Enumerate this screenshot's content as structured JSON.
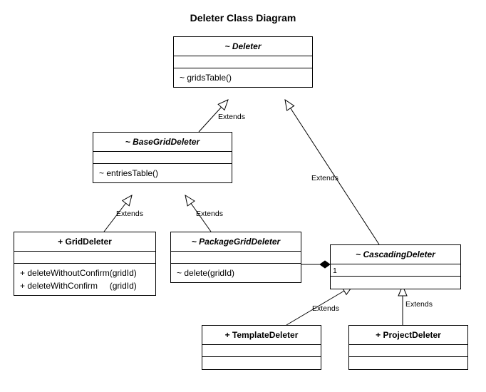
{
  "title": "Deleter Class Diagram",
  "labels": {
    "extends1": "Extends",
    "extends2": "Extends",
    "extends3": "Extends",
    "extends4": "Extends",
    "extends5": "Extends",
    "extends6": "Extends",
    "mult1": "1"
  },
  "classes": {
    "deleter": {
      "name": "~ Deleter",
      "methods": [
        "~ gridsTable()"
      ]
    },
    "baseGridDeleter": {
      "name": "~ BaseGridDeleter",
      "methods": [
        "~ entriesTable()"
      ]
    },
    "gridDeleter": {
      "name": "+ GridDeleter",
      "methods": [
        {
          "sig": "+ deleteWithoutConfirm",
          "args": "(gridId)"
        },
        {
          "sig": "+ deleteWithConfirm",
          "args": "(gridId)"
        }
      ]
    },
    "packageGridDeleter": {
      "name": "~ PackageGridDeleter",
      "methods": [
        "~ delete(gridId)"
      ]
    },
    "cascadingDeleter": {
      "name": "~ CascadingDeleter"
    },
    "templateDeleter": {
      "name": "+ TemplateDeleter"
    },
    "projectDeleter": {
      "name": "+ ProjectDeleter"
    }
  },
  "chart_data": {
    "type": "uml-class-diagram",
    "title": "Deleter Class Diagram",
    "classes": [
      {
        "id": "Deleter",
        "name": "~ Deleter",
        "abstract": true,
        "attributes": [],
        "operations": [
          "~ gridsTable()"
        ]
      },
      {
        "id": "BaseGridDeleter",
        "name": "~ BaseGridDeleter",
        "abstract": true,
        "attributes": [],
        "operations": [
          "~ entriesTable()"
        ]
      },
      {
        "id": "GridDeleter",
        "name": "+ GridDeleter",
        "abstract": false,
        "attributes": [],
        "operations": [
          "+ deleteWithoutConfirm(gridId)",
          "+ deleteWithConfirm(gridId)"
        ]
      },
      {
        "id": "PackageGridDeleter",
        "name": "~ PackageGridDeleter",
        "abstract": true,
        "attributes": [],
        "operations": [
          "~ delete(gridId)"
        ]
      },
      {
        "id": "CascadingDeleter",
        "name": "~ CascadingDeleter",
        "abstract": true,
        "attributes": [],
        "operations": []
      },
      {
        "id": "TemplateDeleter",
        "name": "+ TemplateDeleter",
        "abstract": false,
        "attributes": [],
        "operations": []
      },
      {
        "id": "ProjectDeleter",
        "name": "+ ProjectDeleter",
        "abstract": false,
        "attributes": [],
        "operations": []
      }
    ],
    "relationships": [
      {
        "type": "generalization",
        "label": "Extends",
        "from": "BaseGridDeleter",
        "to": "Deleter"
      },
      {
        "type": "generalization",
        "label": "Extends",
        "from": "CascadingDeleter",
        "to": "Deleter"
      },
      {
        "type": "generalization",
        "label": "Extends",
        "from": "GridDeleter",
        "to": "BaseGridDeleter"
      },
      {
        "type": "generalization",
        "label": "Extends",
        "from": "PackageGridDeleter",
        "to": "BaseGridDeleter"
      },
      {
        "type": "generalization",
        "label": "Extends",
        "from": "TemplateDeleter",
        "to": "CascadingDeleter"
      },
      {
        "type": "generalization",
        "label": "Extends",
        "from": "ProjectDeleter",
        "to": "CascadingDeleter"
      },
      {
        "type": "composition",
        "from": "CascadingDeleter",
        "to": "PackageGridDeleter",
        "fromMultiplicity": "1"
      }
    ]
  }
}
